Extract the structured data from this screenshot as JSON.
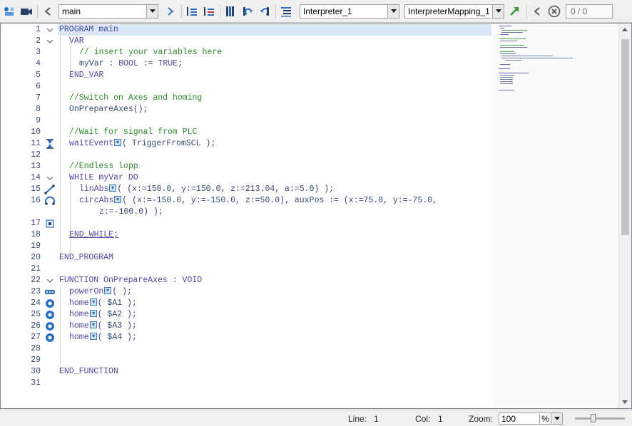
{
  "toolbar": {
    "block_selector": "main",
    "interpreter_selector": "Interpreter_1",
    "mapping_selector": "InterpreterMapping_1",
    "search_counter": "0 / 0"
  },
  "gutter": {
    "line_numbers": [
      "1",
      "2",
      "3",
      "4",
      "5",
      "6",
      "7",
      "8",
      "9",
      "10",
      "11",
      "12",
      "13",
      "14",
      "15",
      "16",
      "17",
      "18",
      "19",
      "20",
      "21",
      "22",
      "23",
      "24",
      "25",
      "26",
      "27",
      "28",
      "29",
      "30",
      "31"
    ]
  },
  "code": {
    "l1": "PROGRAM main",
    "l2": "VAR",
    "l3": "// insert your variables here",
    "l4_name": "myVar",
    "l4_sep1": " : ",
    "l4_type": "BOOL",
    "l4_sep2": " := ",
    "l4_val": "TRUE",
    "l4_end": ";",
    "l5": "END_VAR",
    "l7": "//Switch on Axes and homing",
    "l8": "OnPrepareAxes();",
    "l10": "//Wait for signal from PLC",
    "l11_fn": "waitEvent",
    "l11_args": "( TriggerFromSCL );",
    "l13": "//Endless lopp",
    "l14_kw": "WHILE",
    "l14_var": " myVar ",
    "l14_do": "DO",
    "l15_fn": "linAbs",
    "l15_args": "( (x:=150.0, y:=150.0, z:=213.04, a:=5.0) );",
    "l16_fn": "circAbs",
    "l16_args": "( (x:=-150.0, y:=-150.0, z:=50.0), auxPos := (x:=75.0, y:=-75.0,",
    "l16_cont": "z:=-100.0) );",
    "l18": "END_WHILE;",
    "l20": "END_PROGRAM",
    "l22_kw": "FUNCTION",
    "l22_name": " OnPrepareAxes : ",
    "l22_type": "VOID",
    "l23_fn": "powerOn",
    "l23_args": "( );",
    "l24_fn": "home",
    "l24_args": "( $A1 );",
    "l25_fn": "home",
    "l25_args": "( $A2 );",
    "l26_fn": "home",
    "l26_args": "( $A3 );",
    "l27_fn": "home",
    "l27_args": "( $A4 );",
    "l30": "END_FUNCTION"
  },
  "status": {
    "line_label": "Line:",
    "line_value": "1",
    "col_label": "Col:",
    "col_value": "1",
    "zoom_label": "Zoom:",
    "zoom_value": "100",
    "zoom_unit": "%"
  },
  "colors": {
    "keyword": "#4d4aa0",
    "comment": "#2e8b2e",
    "text": "#3a4a6b",
    "current_line": "#d9e6f6",
    "accent_blue": "#2a6fc4",
    "accent_green": "#2e9a3a"
  },
  "icons": [
    "settings-tool-icon",
    "camera-icon",
    "back-arrow-icon",
    "forward-arrow-icon",
    "indent-icon",
    "outdent-icon",
    "bookmark-icon",
    "redo-icon",
    "undo-icon",
    "list-format-icon",
    "go-to-icon",
    "previous-icon",
    "clear-search-icon",
    "wait-event-icon",
    "lin-move-icon",
    "circ-move-icon",
    "end-block-icon",
    "power-on-icon",
    "home-axis-icon"
  ]
}
